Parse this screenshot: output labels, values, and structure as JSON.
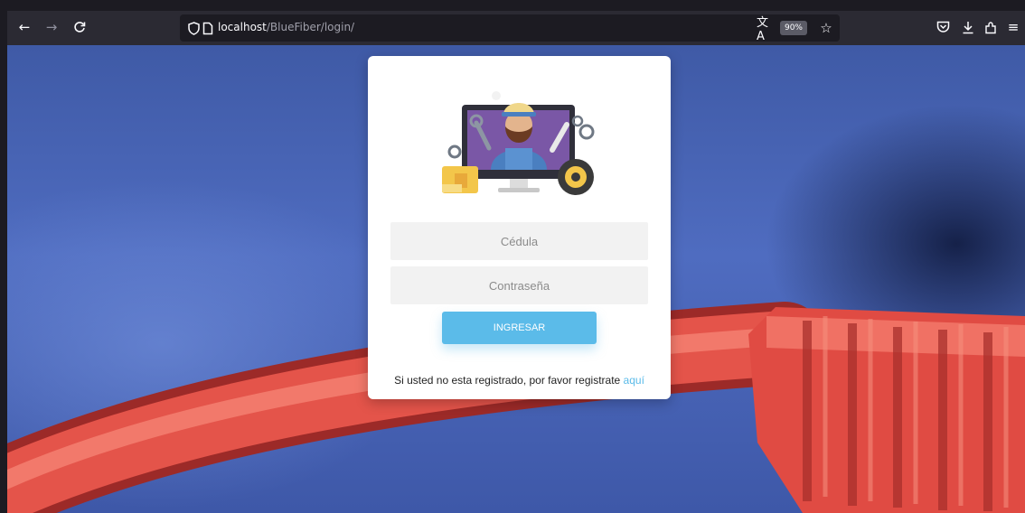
{
  "browser": {
    "url_host": "localhost",
    "url_path": "/BlueFiber/login/",
    "zoom": "90%"
  },
  "login": {
    "cedula_placeholder": "Cédula",
    "password_placeholder": "Contraseña",
    "submit_label": "INGRESAR",
    "register_text": "Si usted no esta registrado, por favor registrate ",
    "register_link": "aquí"
  },
  "colors": {
    "accent": "#5bbbe9",
    "toolbar_bg": "#2b2a33",
    "cable": "#f06155"
  },
  "icons": [
    "back-arrow-icon",
    "forward-arrow-icon",
    "reload-icon",
    "shield-icon",
    "page-icon",
    "translate-icon",
    "star-icon",
    "pocket-icon",
    "download-icon",
    "extensions-icon",
    "menu-icon"
  ]
}
